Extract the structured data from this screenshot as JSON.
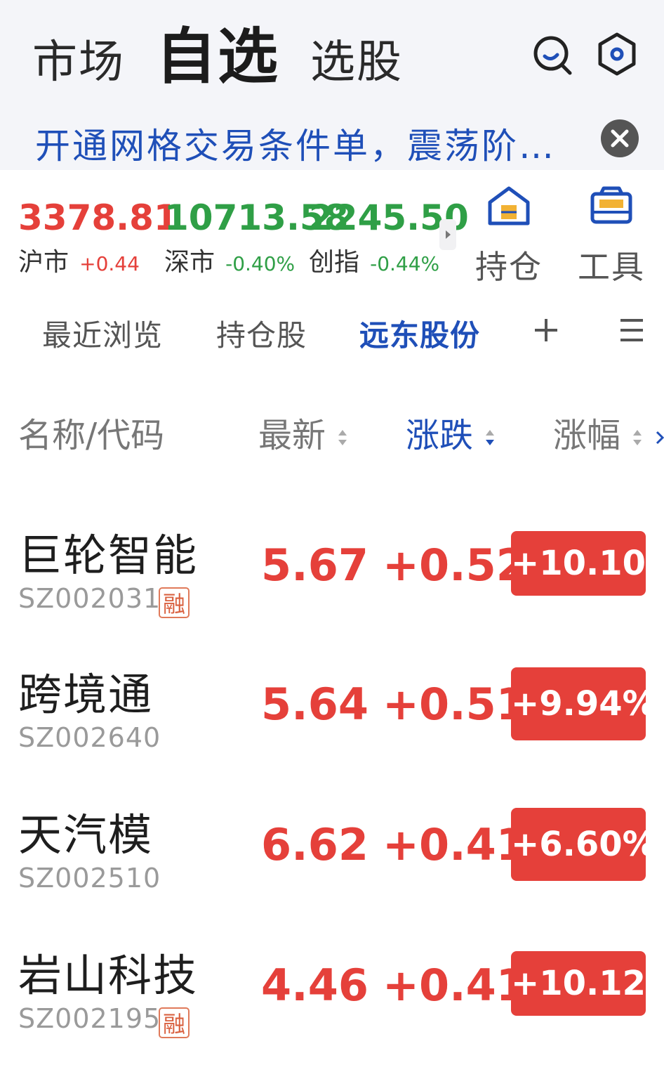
{
  "header": {
    "tabs": [
      {
        "label": "市场"
      },
      {
        "label": "自选",
        "active": true
      },
      {
        "label": "选股"
      }
    ],
    "icons": [
      "search-icon",
      "settings-icon"
    ]
  },
  "banner": {
    "text": "开通网格交易条件单，震荡阶…",
    "close_icon": "close-icon"
  },
  "indices": [
    {
      "value": "3378.81",
      "name": "沪市",
      "change": "+0.44",
      "trend": "up"
    },
    {
      "value": "10713.58",
      "name": "深市",
      "change": "-0.40%",
      "trend": "down"
    },
    {
      "value": "2245.50",
      "name": "创指",
      "change": "-0.44%",
      "trend": "down"
    }
  ],
  "quick_actions": [
    {
      "label": "持仓",
      "icon": "holdings-house-icon"
    },
    {
      "label": "工具",
      "icon": "toolbox-icon"
    }
  ],
  "groups": [
    {
      "label": "最近浏览"
    },
    {
      "label": "持仓股"
    },
    {
      "label": "远东股份",
      "active": true
    }
  ],
  "group_icons": [
    "add-icon",
    "menu-icon"
  ],
  "columns": {
    "name": "名称/代码",
    "latest": "最新",
    "change": "涨跌",
    "pct": "涨幅"
  },
  "stocks": [
    {
      "name": "巨轮智能",
      "code": "SZ002031",
      "margin": "融",
      "price": "5.67",
      "change": "+0.52",
      "pct": "+10.10%"
    },
    {
      "name": "跨境通",
      "code": "SZ002640",
      "margin": "",
      "price": "5.64",
      "change": "+0.51",
      "pct": "+9.94%"
    },
    {
      "name": "天汽模",
      "code": "SZ002510",
      "margin": "",
      "price": "6.62",
      "change": "+0.41",
      "pct": "+6.60%"
    },
    {
      "name": "岩山科技",
      "code": "SZ002195",
      "margin": "融",
      "price": "4.46",
      "change": "+0.41",
      "pct": "+10.12%"
    }
  ],
  "colors": {
    "up": "#e5403a",
    "down": "#2f9f46",
    "accent": "#1f4fb8"
  }
}
